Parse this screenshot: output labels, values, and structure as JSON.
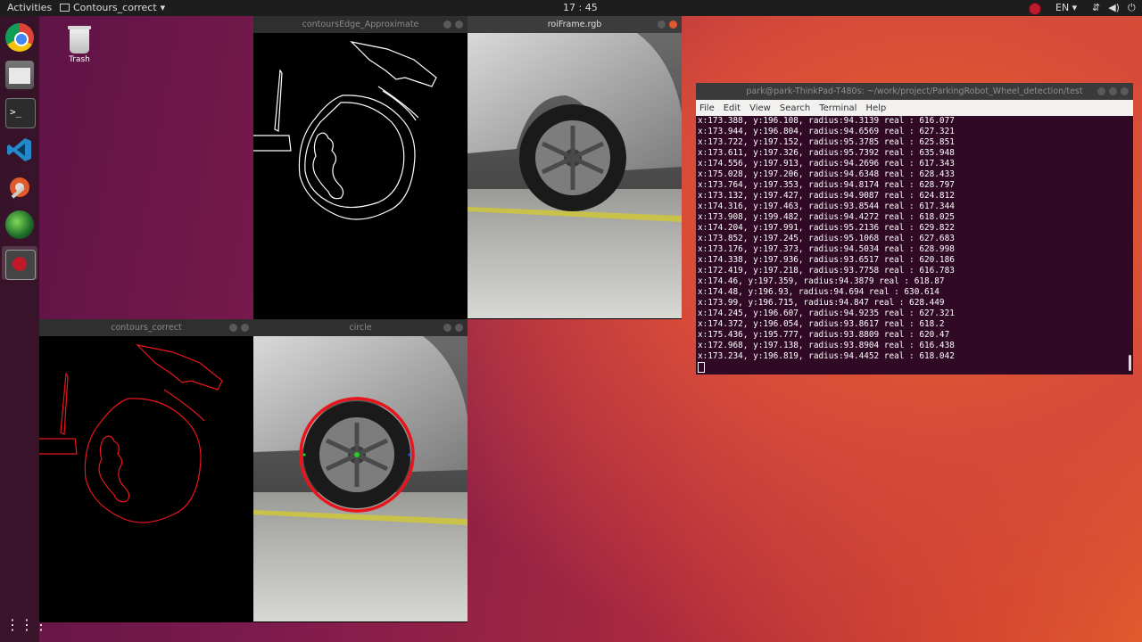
{
  "topbar": {
    "activities": "Activities",
    "app_name": "Contours_correct",
    "clock": "17 : 45",
    "lang": "EN"
  },
  "desktop": {
    "trash_label": "Trash"
  },
  "windows": {
    "edge": {
      "title": "contoursEdge_Approximate"
    },
    "roi": {
      "title": "roiFrame.rgb"
    },
    "correct": {
      "title": "contours_correct"
    },
    "circle": {
      "title": "circle"
    }
  },
  "terminal": {
    "title": "park@park-ThinkPad-T480s: ~/work/project/ParkingRobot_Wheel_detection/test",
    "menu": [
      "File",
      "Edit",
      "View",
      "Search",
      "Terminal",
      "Help"
    ],
    "lines": [
      "x:173.388, y:196.108, radius:94.3139 real : 616.077",
      "x:173.944, y:196.804, radius:94.6569 real : 627.321",
      "x:173.722, y:197.152, radius:95.3785 real : 625.851",
      "x:173.611, y:197.326, radius:95.7392 real : 635.948",
      "x:174.556, y:197.913, radius:94.2696 real : 617.343",
      "x:175.028, y:197.206, radius:94.6348 real : 628.433",
      "x:173.764, y:197.353, radius:94.8174 real : 628.797",
      "x:173.132, y:197.427, radius:94.9087 real : 624.812",
      "x:174.316, y:197.463, radius:93.8544 real : 617.344",
      "x:173.908, y:199.482, radius:94.4272 real : 618.025",
      "x:174.204, y:197.991, radius:95.2136 real : 629.822",
      "x:173.852, y:197.245, radius:95.1068 real : 627.683",
      "x:173.176, y:197.373, radius:94.5034 real : 628.998",
      "x:174.338, y:197.936, radius:93.6517 real : 620.186",
      "x:172.419, y:197.218, radius:93.7758 real : 616.783",
      "x:174.46, y:197.359, radius:94.3879 real : 618.87",
      "x:174.48, y:196.93, radius:94.694 real : 630.614",
      "x:173.99, y:196.715, radius:94.847 real : 628.449",
      "x:174.245, y:196.607, radius:94.9235 real : 627.321",
      "x:174.372, y:196.054, radius:93.8617 real : 618.2",
      "x:175.436, y:195.777, radius:93.8809 real : 620.47",
      "x:172.968, y:197.138, radius:93.8904 real : 616.438",
      "x:173.234, y:196.819, radius:94.4452 real : 618.042"
    ]
  },
  "colors": {
    "contour_red": "#e8161c",
    "terminal_bg": "#300a24",
    "close_orange": "#e3572b"
  }
}
